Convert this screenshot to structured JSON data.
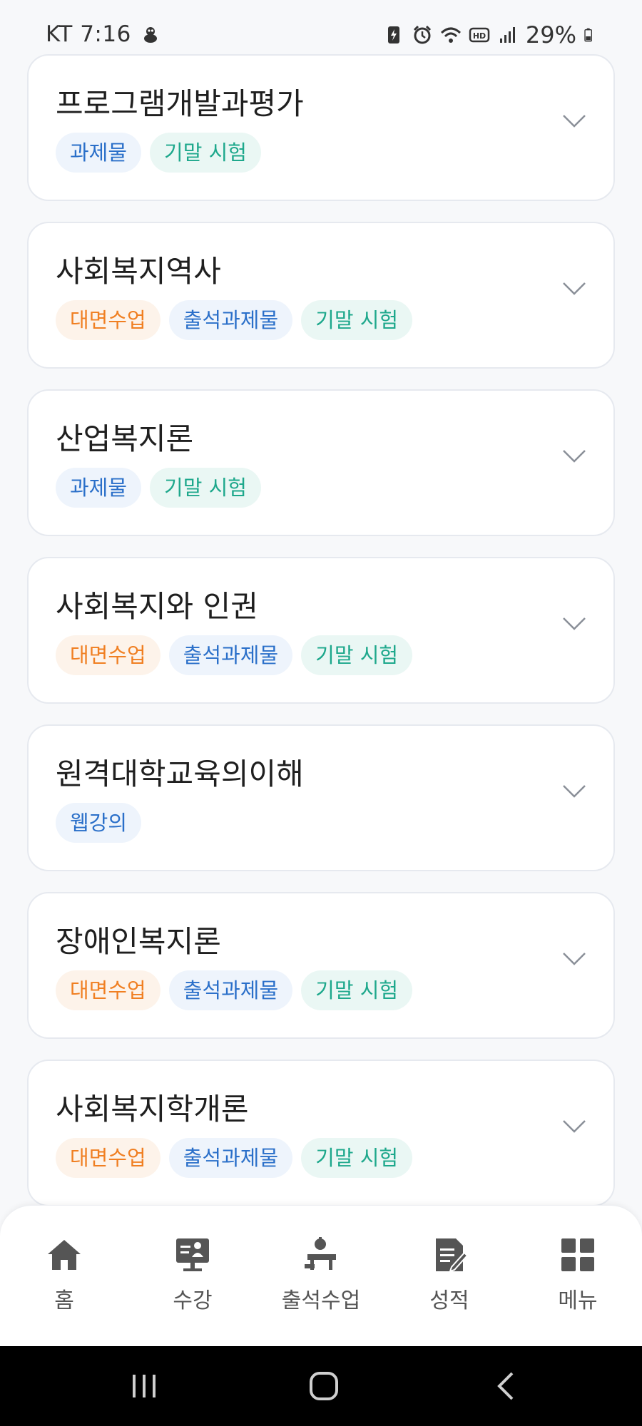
{
  "status_bar": {
    "carrier_time": "KT 7:16",
    "battery": "29%"
  },
  "courses": [
    {
      "title": "프로그램개발과평가",
      "tags": [
        {
          "label": "과제물",
          "color": "blue"
        },
        {
          "label": "기말 시험",
          "color": "green"
        }
      ]
    },
    {
      "title": "사회복지역사",
      "tags": [
        {
          "label": "대면수업",
          "color": "orange"
        },
        {
          "label": "출석과제물",
          "color": "blue"
        },
        {
          "label": "기말 시험",
          "color": "green"
        }
      ]
    },
    {
      "title": "산업복지론",
      "tags": [
        {
          "label": "과제물",
          "color": "blue"
        },
        {
          "label": "기말 시험",
          "color": "green"
        }
      ]
    },
    {
      "title": "사회복지와 인권",
      "tags": [
        {
          "label": "대면수업",
          "color": "orange"
        },
        {
          "label": "출석과제물",
          "color": "blue"
        },
        {
          "label": "기말 시험",
          "color": "green"
        }
      ]
    },
    {
      "title": "원격대학교육의이해",
      "tags": [
        {
          "label": "웹강의",
          "color": "blue"
        }
      ]
    },
    {
      "title": "장애인복지론",
      "tags": [
        {
          "label": "대면수업",
          "color": "orange"
        },
        {
          "label": "출석과제물",
          "color": "blue"
        },
        {
          "label": "기말 시험",
          "color": "green"
        }
      ]
    },
    {
      "title": "사회복지학개론",
      "tags": [
        {
          "label": "대면수업",
          "color": "orange"
        },
        {
          "label": "출석과제물",
          "color": "blue"
        },
        {
          "label": "기말 시험",
          "color": "green"
        }
      ]
    }
  ],
  "bottom_nav": [
    {
      "label": "홈",
      "icon": "home-icon"
    },
    {
      "label": "수강",
      "icon": "lecture-monitor-icon"
    },
    {
      "label": "출석수업",
      "icon": "attendance-desk-icon"
    },
    {
      "label": "성적",
      "icon": "grade-document-icon"
    },
    {
      "label": "메뉴",
      "icon": "grid-menu-icon"
    }
  ],
  "colors": {
    "tag_blue": "#2a6fc9",
    "tag_green": "#1ea88c",
    "tag_orange": "#f07f22",
    "nav_icon": "#555555"
  }
}
